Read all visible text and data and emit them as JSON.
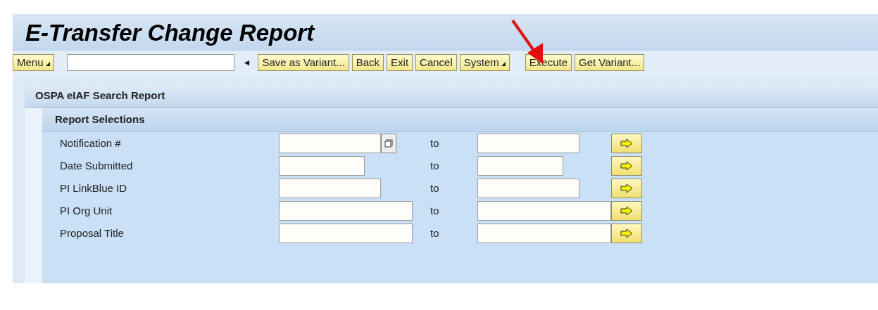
{
  "window": {
    "title": "E-Transfer Change Report"
  },
  "toolbar": {
    "items": [
      {
        "kind": "menu",
        "label": "Menu"
      },
      {
        "kind": "field",
        "value": ""
      },
      {
        "kind": "nav",
        "label": "◄"
      },
      {
        "kind": "button",
        "label": "Save as Variant..."
      },
      {
        "kind": "button",
        "label": "Back"
      },
      {
        "kind": "button",
        "label": "Exit"
      },
      {
        "kind": "button",
        "label": "Cancel"
      },
      {
        "kind": "menu",
        "label": "System"
      },
      {
        "kind": "spacer"
      },
      {
        "kind": "button",
        "label": "Execute",
        "annotated": true
      },
      {
        "kind": "button",
        "label": "Get Variant..."
      }
    ]
  },
  "panel": {
    "title": "OSPA eIAF Search Report",
    "section": {
      "title": "Report Selections",
      "rows": [
        {
          "label": "Notification #",
          "value_help": true,
          "to_label": "to"
        },
        {
          "label": "Date Submitted",
          "value_help": false,
          "to_label": "to"
        },
        {
          "label": "PI LinkBlue ID",
          "value_help": false,
          "to_label": "to"
        },
        {
          "label": "PI Org Unit",
          "value_help": false,
          "to_label": "to"
        },
        {
          "label": "Proposal Title",
          "value_help": false,
          "to_label": "to"
        }
      ]
    }
  }
}
